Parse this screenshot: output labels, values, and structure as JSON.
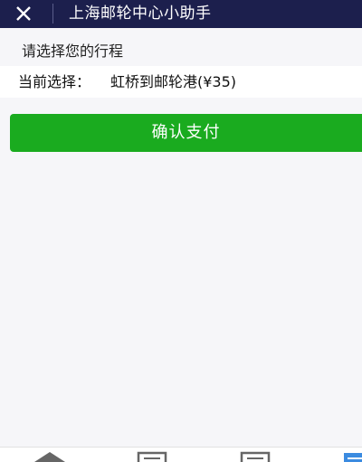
{
  "titlebar": {
    "title": "上海邮轮中心小助手",
    "close_icon": "close-icon"
  },
  "trip": {
    "section_label": "请选择您的行程",
    "current_selection_label": "当前选择：",
    "current_selection_value": "虹桥到邮轮港(¥35)"
  },
  "actions": {
    "confirm_pay_label": "确认支付",
    "button_color": "#1aab1f"
  },
  "tabbar": {
    "tabs": [
      {
        "icon": "home-icon"
      },
      {
        "icon": "document-icon"
      },
      {
        "icon": "document-icon"
      },
      {
        "icon": "document-icon",
        "active": true
      }
    ],
    "active_color": "#3b8be0"
  },
  "colors": {
    "header_bg": "#1c1f4d",
    "page_bg": "#f6f6f9"
  }
}
